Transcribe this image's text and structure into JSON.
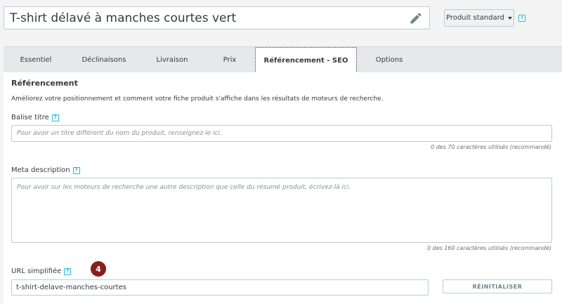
{
  "product": {
    "title": "T-shirt délavé à manches courtes vert",
    "type_label": "Produit standard",
    "help_glyph": "?"
  },
  "tabs": [
    {
      "label": "Essentiel"
    },
    {
      "label": "Déclinaisons"
    },
    {
      "label": "Livraison"
    },
    {
      "label": "Prix"
    },
    {
      "label": "Référencement - SEO"
    },
    {
      "label": "Options"
    }
  ],
  "seo": {
    "section_title": "Référencement",
    "description": "Améliorez votre positionnement et comment votre fiche produit s'affiche dans les résultats de moteurs de recherche.",
    "meta_title": {
      "label": "Balise titre",
      "placeholder": "Pour avoir un titre différent du nom du produit, renseignez-le ici.",
      "counter": "0 des 70 caractères utilisés (recommandé)"
    },
    "meta_description": {
      "label": "Meta description",
      "placeholder": "Pour avoir sur les moteurs de recherche une autre description que celle du résumé produit, écrivez-là ici.",
      "counter": "0 des 160 caractères utilisés (recommandé)"
    },
    "url": {
      "label": "URL simplifiée",
      "value": "t-shirt-delave-manches-courtes",
      "reset_label": "RÉINITIALISER"
    },
    "step_badge": "4"
  },
  "colors": {
    "accent": "#25b9d7",
    "badge": "#8b1d1d"
  }
}
